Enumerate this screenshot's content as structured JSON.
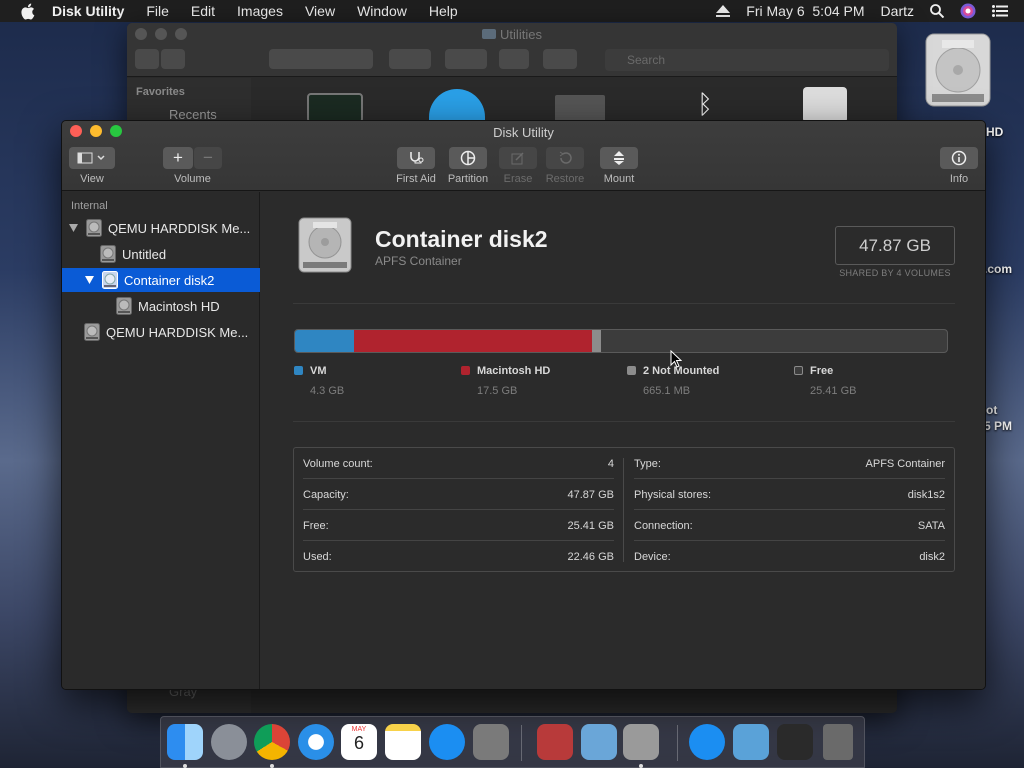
{
  "menubar": {
    "app_name": "Disk Utility",
    "items": [
      "File",
      "Edit",
      "Images",
      "View",
      "Window",
      "Help"
    ],
    "datetime": "Fri May 6  5:04 PM",
    "user": "Dartz"
  },
  "desktop": {
    "label_hd": "HD",
    "label_com": ".com",
    "label_ot": "ot",
    "label_pm": "5 PM"
  },
  "finder": {
    "title": "Utilities",
    "search_placeholder": "Search",
    "favorites": "Favorites",
    "recents": "Recents",
    "gray_tag": "Gray"
  },
  "window": {
    "title": "Disk Utility"
  },
  "toolbar": {
    "view_label": "View",
    "volume_label": "Volume",
    "first_aid_label": "First Aid",
    "partition_label": "Partition",
    "erase_label": "Erase",
    "restore_label": "Restore",
    "mount_label": "Mount",
    "info_label": "Info"
  },
  "sidebar": {
    "header": "Internal",
    "items": [
      {
        "label": "QEMU HARDDISK Me..."
      },
      {
        "label": "Untitled"
      },
      {
        "label": "Container disk2"
      },
      {
        "label": "Macintosh HD"
      },
      {
        "label": "QEMU HARDDISK Me..."
      }
    ]
  },
  "container": {
    "title": "Container disk2",
    "subtitle": "APFS Container",
    "size": "47.87 GB",
    "shared": "SHARED BY 4 VOLUMES"
  },
  "usage": {
    "segments": [
      {
        "name": "VM",
        "value": "4.3 GB",
        "gb": 4.3,
        "color": "#2f86c2"
      },
      {
        "name": "Macintosh HD",
        "value": "17.5 GB",
        "gb": 17.5,
        "color": "#b0232e"
      },
      {
        "name": "2 Not Mounted",
        "value": "665.1 MB",
        "gb": 0.665,
        "color": "#8c8c8c"
      },
      {
        "name": "Free",
        "value": "25.41 GB",
        "gb": 25.41,
        "color": "#3c3c3c"
      }
    ],
    "total_gb": 47.87
  },
  "info": {
    "left": [
      {
        "label": "Volume count:",
        "value": "4"
      },
      {
        "label": "Capacity:",
        "value": "47.87 GB"
      },
      {
        "label": "Free:",
        "value": "25.41 GB"
      },
      {
        "label": "Used:",
        "value": "22.46 GB"
      }
    ],
    "right": [
      {
        "label": "Type:",
        "value": "APFS Container"
      },
      {
        "label": "Physical stores:",
        "value": "disk1s2"
      },
      {
        "label": "Connection:",
        "value": "SATA"
      },
      {
        "label": "Device:",
        "value": "disk2"
      }
    ]
  },
  "calendar": {
    "month": "MAY",
    "day": "6"
  },
  "colors": {
    "selection": "#0a5bd6",
    "close": "#fe5f57",
    "minimize": "#febc2e",
    "zoom": "#28c840"
  }
}
